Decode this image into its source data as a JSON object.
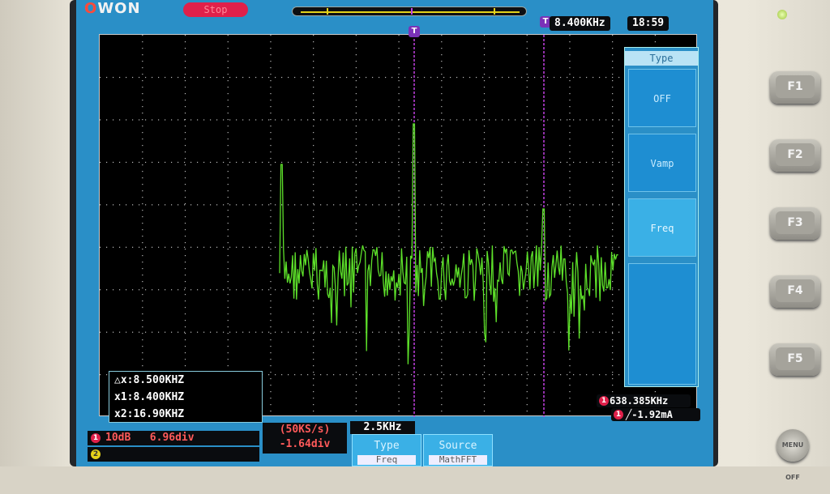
{
  "header": {
    "brand": "OWON",
    "run_state": "Stop",
    "trigger_marker": "T",
    "trigger_freq": "8.400KHz",
    "clock": "18:59"
  },
  "menu": {
    "title": "Type",
    "items": [
      "OFF",
      "Vamp",
      "Freq",
      ""
    ],
    "selected": "Freq"
  },
  "cursors": {
    "delta_x": "△x:8.500KHZ",
    "x1": "x1:8.400KHZ",
    "x2": "x2:16.90KHZ"
  },
  "readouts": {
    "freq": "638.385KHz",
    "trigger": "╱-1.92mA"
  },
  "channels": {
    "ch1_id": "1",
    "ch1_scale": "10dB",
    "ch1_pos": "6.96div",
    "ch2_id": "2"
  },
  "math": {
    "sample_rate": "(50KS/s)",
    "offset": "-1.64div",
    "timebase": "2.5KHz"
  },
  "softkeys": [
    {
      "label": "Type",
      "value": "Freq"
    },
    {
      "label": "Source",
      "value": "MathFFT"
    }
  ],
  "function_keys": [
    "F1",
    "F2",
    "F3",
    "F4",
    "F5"
  ],
  "knob_label": "MENU OFF",
  "colors": {
    "screen_bg": "#2a8fc7",
    "trace": "#5de02a",
    "cursor": "#c040e0",
    "alert": "#e0204a"
  },
  "chart_data": {
    "type": "line",
    "title": "",
    "xlabel": "",
    "ylabel": "",
    "grid": true,
    "series": [
      {
        "values": []
      }
    ]
  }
}
